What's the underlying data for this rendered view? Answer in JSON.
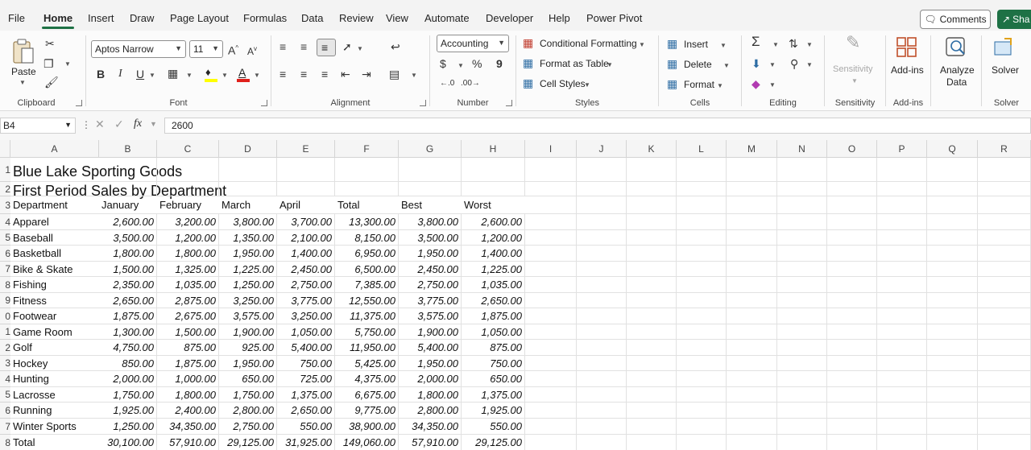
{
  "menu": {
    "tabs": [
      "File",
      "Home",
      "Insert",
      "Draw",
      "Page Layout",
      "Formulas",
      "Data",
      "Review",
      "View",
      "Automate",
      "Developer",
      "Help",
      "Power Pivot"
    ],
    "active": "Home",
    "comments_label": "Comments",
    "share_label": "Sha"
  },
  "ribbon": {
    "clipboard": {
      "paste_label": "Paste",
      "group_label": "Clipboard"
    },
    "font": {
      "font_name": "Aptos Narrow",
      "font_size": "11",
      "group_label": "Font",
      "bold": "B",
      "italic": "I",
      "underline": "U"
    },
    "alignment": {
      "group_label": "Alignment"
    },
    "number": {
      "format": "Accounting",
      "currency": "$",
      "percent": "%",
      "comma": "9",
      "group_label": "Number"
    },
    "styles": {
      "conditional": "Conditional Formatting",
      "format_table": "Format as Table",
      "cell_styles": "Cell Styles",
      "group_label": "Styles"
    },
    "cells": {
      "insert": "Insert",
      "delete": "Delete",
      "format": "Format",
      "group_label": "Cells"
    },
    "editing": {
      "group_label": "Editing"
    },
    "sensitivity": {
      "label": "Sensitivity",
      "group_label": "Sensitivity"
    },
    "addins": {
      "label": "Add-ins",
      "group_label": "Add-ins"
    },
    "analyze": {
      "label1": "Analyze",
      "label2": "Data"
    },
    "solver": {
      "label": "Solver",
      "group_label": "Solver"
    }
  },
  "formula_bar": {
    "name_box": "B4",
    "formula": "2600"
  },
  "grid": {
    "columns": [
      "A",
      "B",
      "C",
      "D",
      "E",
      "F",
      "G",
      "H",
      "I",
      "J",
      "K",
      "L",
      "M",
      "N",
      "O",
      "P",
      "Q",
      "R"
    ],
    "row_numbers": [
      "1",
      "2",
      "3",
      "4",
      "5",
      "6",
      "7",
      "8",
      "9",
      "0",
      "1",
      "2",
      "3",
      "4",
      "5",
      "6",
      "7",
      "8"
    ],
    "title": "Blue Lake Sporting Goods",
    "subtitle": "First Period Sales by Department",
    "headers": [
      "Department",
      "January",
      "February",
      "March",
      "April",
      "Total",
      "Best",
      "Worst"
    ],
    "rows": [
      [
        "Apparel",
        "2,600.00",
        "3,200.00",
        "3,800.00",
        "3,700.00",
        "13,300.00",
        "3,800.00",
        "2,600.00"
      ],
      [
        "Baseball",
        "3,500.00",
        "1,200.00",
        "1,350.00",
        "2,100.00",
        "8,150.00",
        "3,500.00",
        "1,200.00"
      ],
      [
        "Basketball",
        "1,800.00",
        "1,800.00",
        "1,950.00",
        "1,400.00",
        "6,950.00",
        "1,950.00",
        "1,400.00"
      ],
      [
        "Bike & Skate",
        "1,500.00",
        "1,325.00",
        "1,225.00",
        "2,450.00",
        "6,500.00",
        "2,450.00",
        "1,225.00"
      ],
      [
        "Fishing",
        "2,350.00",
        "1,035.00",
        "1,250.00",
        "2,750.00",
        "7,385.00",
        "2,750.00",
        "1,035.00"
      ],
      [
        "Fitness",
        "2,650.00",
        "2,875.00",
        "3,250.00",
        "3,775.00",
        "12,550.00",
        "3,775.00",
        "2,650.00"
      ],
      [
        "Footwear",
        "1,875.00",
        "2,675.00",
        "3,575.00",
        "3,250.00",
        "11,375.00",
        "3,575.00",
        "1,875.00"
      ],
      [
        "Game Room",
        "1,300.00",
        "1,500.00",
        "1,900.00",
        "1,050.00",
        "5,750.00",
        "1,900.00",
        "1,050.00"
      ],
      [
        "Golf",
        "4,750.00",
        "875.00",
        "925.00",
        "5,400.00",
        "11,950.00",
        "5,400.00",
        "875.00"
      ],
      [
        "Hockey",
        "850.00",
        "1,875.00",
        "1,950.00",
        "750.00",
        "5,425.00",
        "1,950.00",
        "750.00"
      ],
      [
        "Hunting",
        "2,000.00",
        "1,000.00",
        "650.00",
        "725.00",
        "4,375.00",
        "2,000.00",
        "650.00"
      ],
      [
        "Lacrosse",
        "1,750.00",
        "1,800.00",
        "1,750.00",
        "1,375.00",
        "6,675.00",
        "1,800.00",
        "1,375.00"
      ],
      [
        "Running",
        "1,925.00",
        "2,400.00",
        "2,800.00",
        "2,650.00",
        "9,775.00",
        "2,800.00",
        "1,925.00"
      ],
      [
        "Winter Sports",
        "1,250.00",
        "34,350.00",
        "2,750.00",
        "550.00",
        "38,900.00",
        "34,350.00",
        "550.00"
      ],
      [
        "Total",
        "30,100.00",
        "57,910.00",
        "29,125.00",
        "31,925.00",
        "149,060.00",
        "57,910.00",
        "29,125.00"
      ]
    ]
  }
}
